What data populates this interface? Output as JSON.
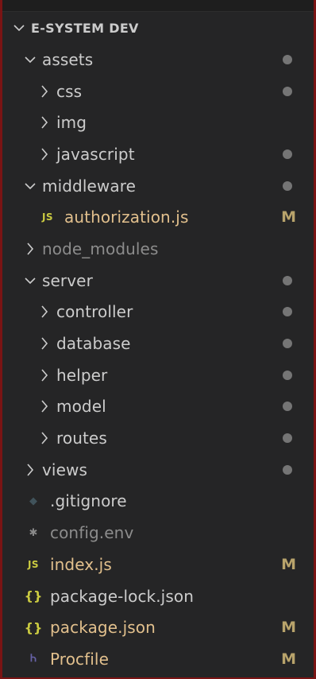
{
  "explorer": {
    "section_title": "E-SYSTEM DEV",
    "items": [
      {
        "label": "assets",
        "type": "folder",
        "expanded": true,
        "depth": 1,
        "dot": true
      },
      {
        "label": "css",
        "type": "folder",
        "expanded": false,
        "depth": 2,
        "dot": true
      },
      {
        "label": "img",
        "type": "folder",
        "expanded": false,
        "depth": 2,
        "dot": false
      },
      {
        "label": "javascript",
        "type": "folder",
        "expanded": false,
        "depth": 2,
        "dot": true
      },
      {
        "label": "middleware",
        "type": "folder",
        "expanded": true,
        "depth": 1,
        "dot": true
      },
      {
        "label": "authorization.js",
        "type": "file",
        "icon": "js-icon",
        "depth": 2,
        "badge": "M",
        "modified": true
      },
      {
        "label": "node_modules",
        "type": "folder",
        "expanded": false,
        "depth": 1,
        "dim": true
      },
      {
        "label": "server",
        "type": "folder",
        "expanded": true,
        "depth": 1,
        "dot": true
      },
      {
        "label": "controller",
        "type": "folder",
        "expanded": false,
        "depth": 2,
        "dot": true
      },
      {
        "label": "database",
        "type": "folder",
        "expanded": false,
        "depth": 2,
        "dot": true
      },
      {
        "label": "helper",
        "type": "folder",
        "expanded": false,
        "depth": 2,
        "dot": true
      },
      {
        "label": "model",
        "type": "folder",
        "expanded": false,
        "depth": 2,
        "dot": true
      },
      {
        "label": "routes",
        "type": "folder",
        "expanded": false,
        "depth": 2,
        "dot": true
      },
      {
        "label": "views",
        "type": "folder",
        "expanded": false,
        "depth": 1,
        "dot": true
      },
      {
        "label": ".gitignore",
        "type": "file",
        "icon": "git-icon",
        "depth": 1
      },
      {
        "label": "config.env",
        "type": "file",
        "icon": "gear-icon",
        "depth": 1,
        "dim": true
      },
      {
        "label": "index.js",
        "type": "file",
        "icon": "js-icon",
        "depth": 1,
        "badge": "M",
        "modified": true
      },
      {
        "label": "package-lock.json",
        "type": "file",
        "icon": "json-icon",
        "depth": 1
      },
      {
        "label": "package.json",
        "type": "file",
        "icon": "json-icon",
        "depth": 1,
        "badge": "M",
        "modified": true
      },
      {
        "label": "Procfile",
        "type": "file",
        "icon": "heroku-icon",
        "depth": 1,
        "badge": "M",
        "modified": true
      }
    ],
    "icon_glyphs": {
      "js-icon": "JS",
      "json-icon": "{}",
      "git-icon": "◆",
      "gear-icon": "✱",
      "heroku-icon": "Ꮒ"
    }
  },
  "colors": {
    "background": "#252526",
    "text": "#cccccc",
    "modified_text": "#e2c08d",
    "dim_text": "#8c8c8c",
    "dot": "#8a8a8a",
    "js_icon": "#cbcb41",
    "heroku_icon": "#6762a6",
    "frame_border": "#7a1414"
  }
}
